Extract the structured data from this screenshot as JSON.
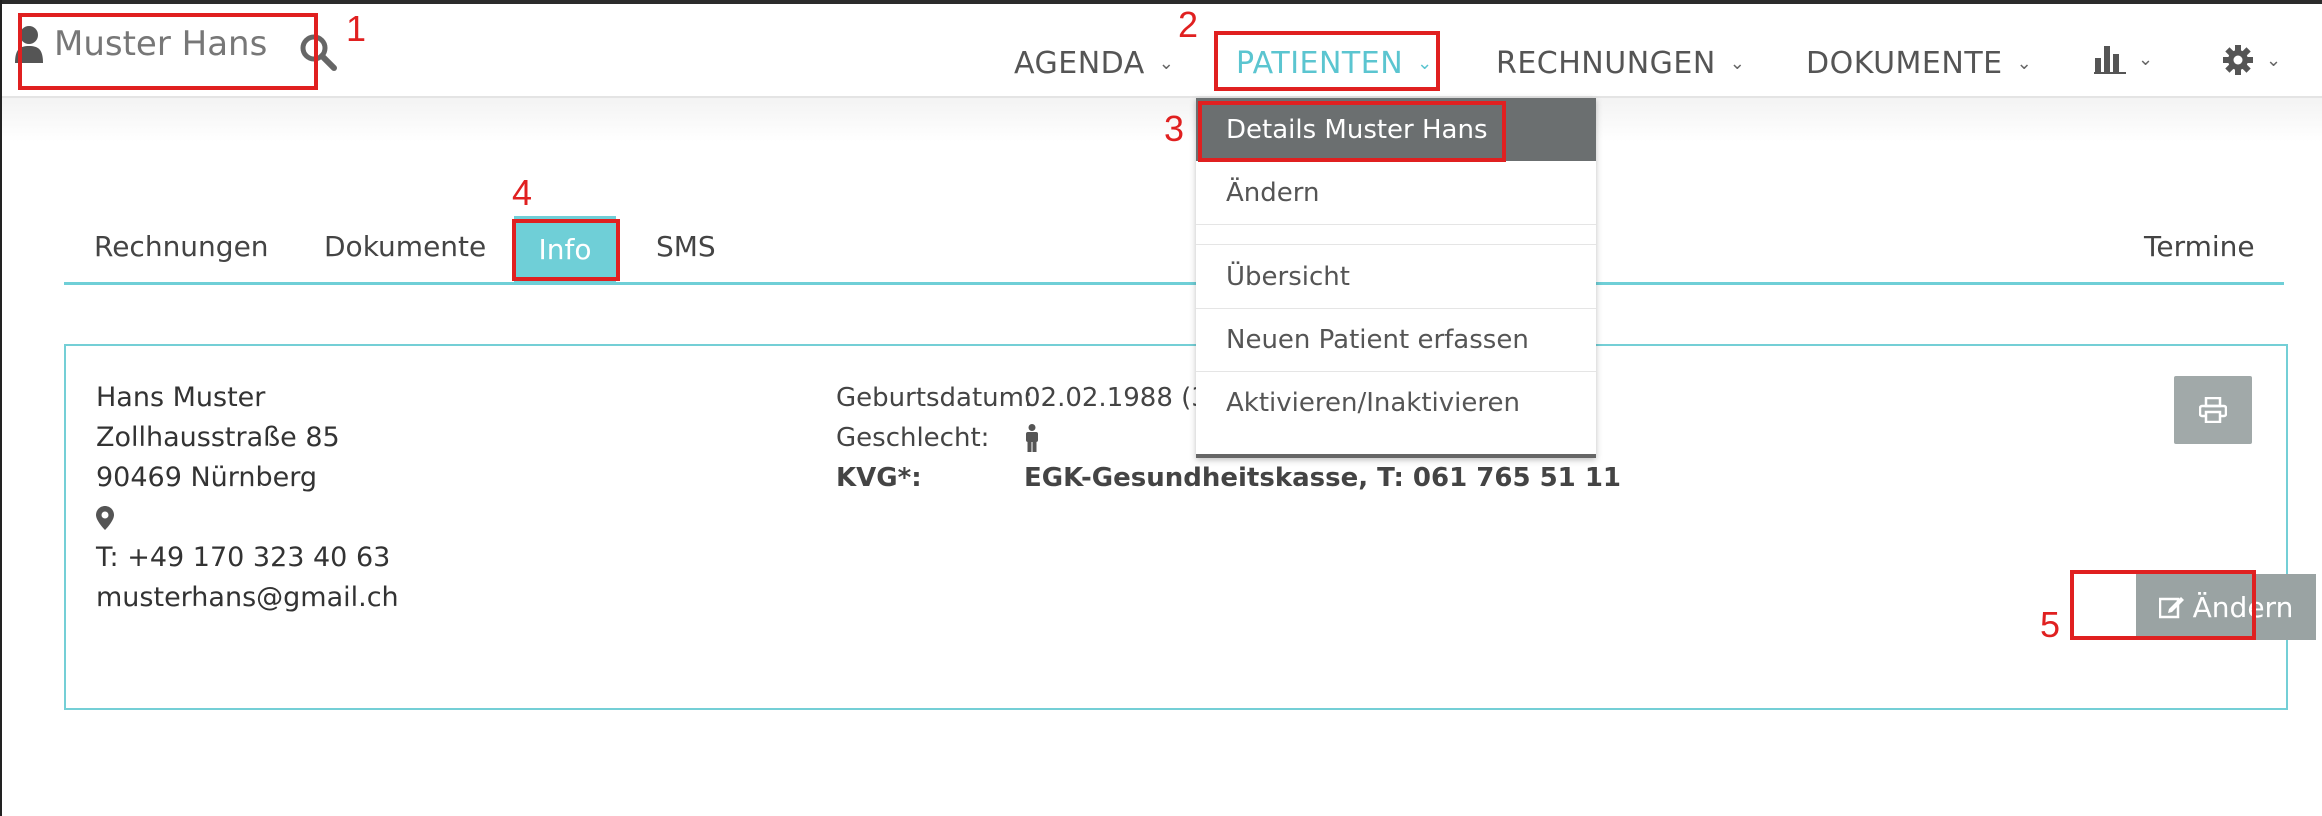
{
  "header": {
    "patient_name": "Muster Hans",
    "nav": [
      {
        "label": "AGENDA"
      },
      {
        "label": "PATIENTEN"
      },
      {
        "label": "RECHNUNGEN"
      },
      {
        "label": "DOKUMENTE"
      }
    ],
    "icons": [
      "user-icon",
      "search-icon",
      "bar-chart-icon",
      "gear-icon"
    ],
    "accent_color": "#5bc5d0"
  },
  "dropdown": {
    "items": [
      {
        "label": "Details Muster Hans",
        "active": true
      },
      {
        "label": "Ändern"
      },
      {
        "label": ""
      },
      {
        "label": "Übersicht"
      },
      {
        "label": "Neuen Patient erfassen"
      },
      {
        "label": "Aktivieren/Inaktivieren"
      }
    ]
  },
  "tabs": [
    {
      "label": "Rechnungen"
    },
    {
      "label": "Dokumente"
    },
    {
      "label": "Info",
      "active": true
    },
    {
      "label": "SMS"
    },
    {
      "label": "Termine"
    }
  ],
  "patient": {
    "name": "Hans Muster",
    "street": "Zollhausstraße 85",
    "city": "90469 Nürnberg",
    "phone": "T: +49 170 323 40 63",
    "email": "musterhans@gmail.ch",
    "birth_label": "Geburtsdatum:",
    "birth_value": "02.02.1988  (3",
    "gender_label": "Geschlecht:",
    "kvg_label": "KVG*:",
    "kvg_value": "EGK-Gesundheitskasse, T: 061 765 51 11"
  },
  "buttons": {
    "edit_label": "Ändern"
  },
  "annotations": [
    "1",
    "2",
    "3",
    "4",
    "5"
  ]
}
